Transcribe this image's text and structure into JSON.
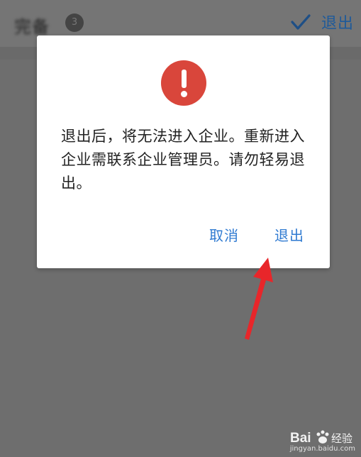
{
  "header": {
    "title": "完备",
    "badge": "3",
    "exit_label": "退出"
  },
  "dialog": {
    "icon": "exclamation-icon",
    "message": "退出后，将无法进入企业。重新进入企业需联系企业管理员。请勿轻易退出。",
    "cancel_label": "取消",
    "confirm_label": "退出"
  },
  "annotation": {
    "arrow_color": "#e8262a"
  },
  "watermark": {
    "brand": "Bai 经验",
    "url": "jingyan.baidu.com"
  },
  "colors": {
    "overlay": "#6e6e6e",
    "accent": "#2f7ad1",
    "alert": "#d9463b"
  }
}
